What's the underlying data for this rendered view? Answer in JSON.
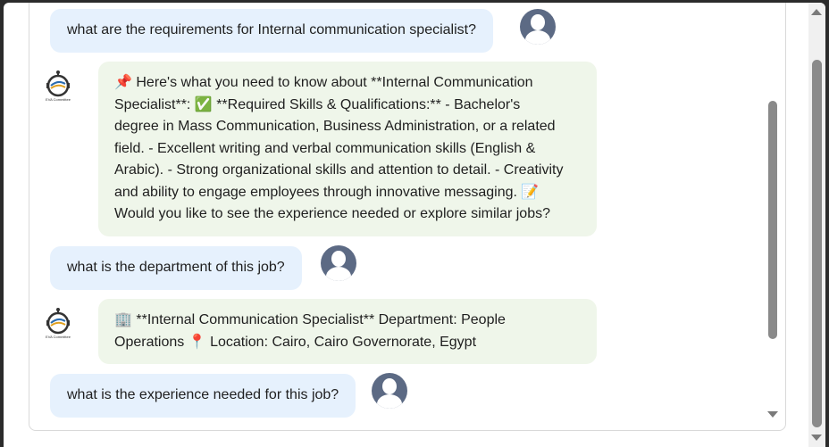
{
  "messages": [
    {
      "role": "user",
      "text": "what are the requirements for Internal communication specialist?"
    },
    {
      "role": "bot",
      "lines": [
        "📌 Here's what you need to know about **Internal Communication",
        "Specialist**: ✅ **Required Skills & Qualifications:** - Bachelor's",
        "degree in Mass Communication, Business Administration, or a related",
        "field. - Excellent writing and verbal communication skills (English &",
        "Arabic). - Strong organizational skills and attention to detail. - Creativity",
        "and ability to engage employees through innovative messaging. 📝",
        "Would you like to see the experience needed or explore similar jobs?"
      ]
    },
    {
      "role": "user",
      "text": "what is the department of this job?"
    },
    {
      "role": "bot",
      "lines": [
        "🏢 **Internal Communication Specialist** Department: People",
        "Operations 📍 Location: Cairo, Cairo Governorate, Egypt"
      ]
    },
    {
      "role": "user",
      "text": "what is the experience needed for this job?"
    }
  ],
  "bot_avatar": {
    "icon": "robot-icon",
    "caption": "EVA Committee"
  },
  "user_avatar": {
    "icon": "user-icon"
  },
  "colors": {
    "user_bubble": "#e6f1fd",
    "bot_bubble": "#eff6ea",
    "avatar": "#5c6a84"
  }
}
